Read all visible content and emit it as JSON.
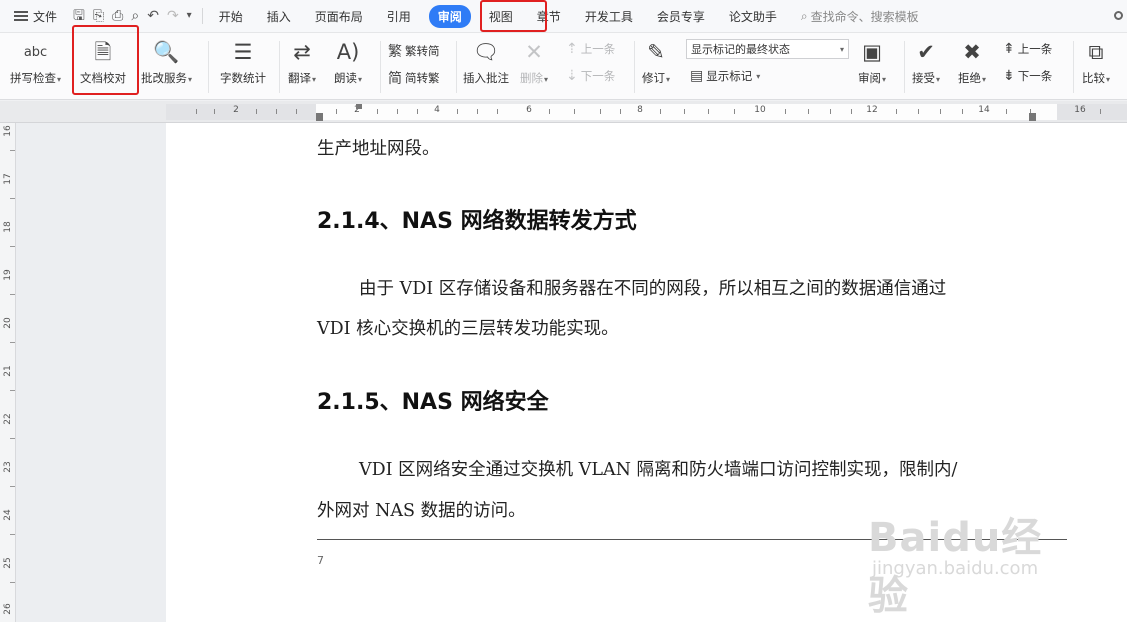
{
  "menubar": {
    "file": "文件",
    "tabs": [
      "开始",
      "插入",
      "页面布局",
      "引用",
      "审阅",
      "视图",
      "章节",
      "开发工具",
      "会员专享",
      "论文助手"
    ],
    "active_tab": "审阅",
    "search": "查找命令、搜索模板"
  },
  "ribbon": {
    "spell_check": "拼写检查",
    "doc_proofread": "文档校对",
    "revise_service": "批改服务",
    "word_count": "字数统计",
    "translate": "翻译",
    "read_aloud": "朗读",
    "trad_to_simp": "繁转简",
    "simp_to_trad": "简转繁",
    "insert_comment": "插入批注",
    "delete": "删除",
    "prev_comment": "上一条",
    "next_comment": "下一条",
    "track_changes": "修订",
    "display_mode": "显示标记的最终状态",
    "show_markup": "显示标记",
    "review": "审阅",
    "accept": "接受",
    "reject": "拒绝",
    "prev_change": "上一条",
    "next_change": "下一条",
    "compare": "比较",
    "abc": "abc"
  },
  "ruler": {
    "h_numbers": [
      "2",
      "2",
      "4",
      "6",
      "8",
      "10",
      "12",
      "14",
      "16"
    ],
    "v_numbers": [
      "16",
      "17",
      "18",
      "19",
      "20",
      "21",
      "22",
      "23",
      "24",
      "25",
      "26"
    ]
  },
  "document": {
    "line1": "生产地址网段。",
    "heading1": "2.1.4、NAS 网络数据转发方式",
    "para1_line1": "由于 VDI 区存储设备和服务器在不同的网段，所以相互之间的数据通信通过",
    "para1_line2": "VDI 核心交换机的三层转发功能实现。",
    "heading2": "2.1.5、NAS 网络安全",
    "para2_line1": "VDI 区网络安全通过交换机 VLAN 隔离和防火墙端口访问控制实现，限制内/",
    "para2_line2": "外网对 NAS 数据的访问。",
    "page_number": "7"
  },
  "watermark": {
    "logo": "Baidu经验",
    "url": "jingyan.baidu.com"
  },
  "colors": {
    "accent": "#2f7cf6",
    "highlight": "#e02020"
  }
}
